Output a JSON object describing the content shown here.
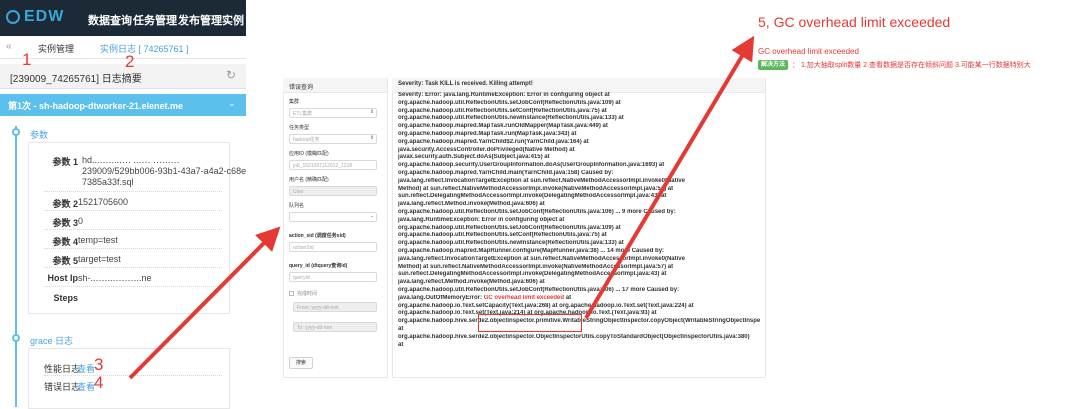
{
  "app": {
    "logo": "EDW",
    "nav": [
      "数据查询",
      "任务管理",
      "发布管理",
      "实例"
    ]
  },
  "breadcrumb": {
    "back_icon": "«",
    "item1": "实例管理",
    "item2": "实例日志 [ 74265761 ]"
  },
  "log_summary": {
    "title": "[239009_74265761] 日志摘要",
    "refresh_icon": "↻"
  },
  "host_header": {
    "label": "第1次 - sh-hadoop-dtworker-21.elenet.me",
    "caret": "⌄"
  },
  "params": {
    "section_title": "参数",
    "rows": [
      {
        "label": "参数 1",
        "value_line1": "hd...‥‥...‥‥ ..‥‥ ‥‥.‥‥",
        "value_line2": "239009/529bb006-93b1-43a7-a4a2-c68e",
        "value_line3": "7385a33f.sql"
      },
      {
        "label": "参数 2",
        "value": "1521705600"
      },
      {
        "label": "参数 3",
        "value": "0"
      },
      {
        "label": "参数 4",
        "value": "temp=test"
      },
      {
        "label": "参数 5",
        "value": "target=test"
      },
      {
        "label": "Host Ip",
        "value": "sh-..‥‥..‥‥‥‥..ne"
      },
      {
        "label": "Steps",
        "value": ""
      }
    ]
  },
  "grace": {
    "section_title": "grace 日志",
    "perf_label": "性能日志",
    "perf_link": "查看",
    "err_label": "错误日志",
    "err_link": "查看"
  },
  "annotations": {
    "n1": "1",
    "n2": "2",
    "n3": "3",
    "n4": "4"
  },
  "query_panel": {
    "title": "错误查询",
    "cluster_label": "集群",
    "cluster_value": "ETL集群",
    "task_type_label": "任务类型",
    "task_type_value": "hadoop任务",
    "app_id_label": "应用ID (模糊匹配)",
    "app_id_value": "job_1521097112012_1218",
    "user_label": "用户名 (精确匹配)",
    "user_value": "User",
    "queue_label": "队列名",
    "queue_value": "",
    "action_label": "action_sid (调度任务sid)",
    "action_placeholder": "actionSid",
    "query_label": "query_id (dtquery查询id)",
    "query_placeholder": "queryId",
    "time_label": "完成时间",
    "from_placeholder": "From: yyyy-dd-mm",
    "to_placeholder": "To: yyyy-dd-mm",
    "search_button": "搜索"
  },
  "log": {
    "header": "Severity: Task KILL is received. Killing attempt!",
    "lines": [
      "Severity: Error: java.lang.RuntimeException: Error in configuring object at",
      "org.apache.hadoop.util.ReflectionUtils.setJobConf(ReflectionUtils.java:109) at",
      "org.apache.hadoop.util.ReflectionUtils.setConf(ReflectionUtils.java:75) at",
      "org.apache.hadoop.util.ReflectionUtils.newInstance(ReflectionUtils.java:133) at",
      "org.apache.hadoop.mapred.MapTask.runOldMapper(MapTask.java:449) at",
      "org.apache.hadoop.mapred.MapTask.run(MapTask.java:343) at",
      "org.apache.hadoop.mapred.YarnChild$2.run(YarnChild.java:164) at",
      "java.security.AccessController.doPrivileged(Native Method) at",
      "javax.security.auth.Subject.doAs(Subject.java:415) at",
      "org.apache.hadoop.security.UserGroupInformation.doAs(UserGroupInformation.java:1693) at",
      "org.apache.hadoop.mapred.YarnChild.main(YarnChild.java:158) Caused by:",
      "java.lang.reflect.InvocationTargetException at sun.reflect.NativeMethodAccessorImpl.invoke0(Native",
      "Method) at sun.reflect.NativeMethodAccessorImpl.invoke(NativeMethodAccessorImpl.java:57) at",
      "sun.reflect.DelegatingMethodAccessorImpl.invoke(DelegatingMethodAccessorImpl.java:43) at",
      "java.lang.reflect.Method.invoke(Method.java:606) at",
      "org.apache.hadoop.util.ReflectionUtils.setJobConf(ReflectionUtils.java:106) ... 9 more Caused by:",
      "java.lang.RuntimeException: Error in configuring object at",
      "org.apache.hadoop.util.ReflectionUtils.setJobConf(ReflectionUtils.java:109) at",
      "org.apache.hadoop.util.ReflectionUtils.setConf(ReflectionUtils.java:75) at",
      "org.apache.hadoop.util.ReflectionUtils.newInstance(ReflectionUtils.java:133) at",
      "org.apache.hadoop.mapred.MapRunner.configure(MapRunner.java:38) ... 14 more Caused by:",
      "java.lang.reflect.InvocationTargetException at sun.reflect.NativeMethodAccessorImpl.invoke0(Native",
      "Method) at sun.reflect.NativeMethodAccessorImpl.invoke(NativeMethodAccessorImpl.java:57) at",
      "sun.reflect.DelegatingMethodAccessorImpl.invoke(DelegatingMethodAccessorImpl.java:43) at",
      "java.lang.reflect.Method.invoke(Method.java:606) at",
      "org.apache.hadoop.util.ReflectionUtils.setJobConf(ReflectionUtils.java:106) ... 17 more Caused by:"
    ],
    "oom_prefix": "java.lang.OutOfMemoryError: ",
    "oom_highlight": "GC overhead limit exceeded",
    "oom_suffix": " at",
    "tail_lines": [
      "org.apache.hadoop.io.Text.setCapacity(Text.java:268) at org.apache.hadoop.io.Text.set(Text.java:224) at",
      "org.apache.hadoop.io.Text.set(Text.java:214) at org.apache.hadoop.io.Text.(Text.java:93) at",
      "org.apache.hadoop.hive.serde2.objectinspector.primitive.WritableStringObjectInspector.copyObject(WritableStringObjectInspector.java:36)",
      "at",
      "org.apache.hadoop.hive.serde2.objectinspector.ObjectInspectorUtils.copyToStandardObject(ObjectInspectorUtils.java:380)",
      "at"
    ]
  },
  "callout": {
    "title": "5, GC overhead limit exceeded",
    "subtitle": "GC overhead limit exceeded",
    "badge": "解决方法",
    "solution": "： 1.加大抽取split数量 2.查看数据是否存在倾斜问题 3.可能某一行数据特别大"
  },
  "colors": {
    "accent": "#5bc0eb",
    "link": "#4aa3df",
    "annotation_red": "#e53935",
    "topbar": "#1c2a38",
    "badge_green": "#5cb85c"
  }
}
